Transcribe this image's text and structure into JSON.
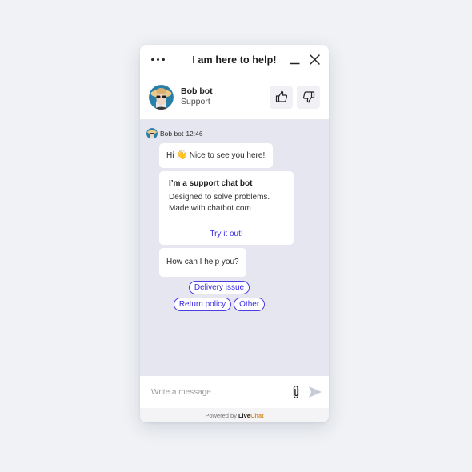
{
  "window": {
    "title": "I am here to help!",
    "menu_icon": "more-dots-icon",
    "minimize_icon": "minimize-icon",
    "close_icon": "close-icon"
  },
  "agent": {
    "name": "Bob bot",
    "role": "Support",
    "avatar_icon": "bot-avatar",
    "thumbs_up_icon": "thumbs-up-icon",
    "thumbs_down_icon": "thumbs-down-icon"
  },
  "conversation": {
    "sender": "Bob bot",
    "time": "12:46",
    "messages": [
      {
        "type": "text",
        "prefix": "Hi",
        "emoji": "👋",
        "suffix": "Nice to see you here!"
      },
      {
        "type": "card",
        "title": "I’m a support chat bot",
        "lines": [
          "Designed to solve problems.",
          "Made with chatbot.com"
        ],
        "action": "Try it out!"
      },
      {
        "type": "text",
        "text": "How can I help you?"
      }
    ],
    "quick_replies": [
      "Delivery issue",
      "Return policy",
      "Other"
    ]
  },
  "composer": {
    "placeholder": "Write a message…",
    "value": "",
    "attach_icon": "paperclip-icon",
    "send_icon": "send-icon"
  },
  "footer": {
    "prefix": "Powered by",
    "brand_part1": "Live",
    "brand_part2": "Chat"
  },
  "colors": {
    "accent": "#3b2ce0",
    "messages_bg": "#e6e6f1",
    "brand_chat": "#d98c2a"
  }
}
